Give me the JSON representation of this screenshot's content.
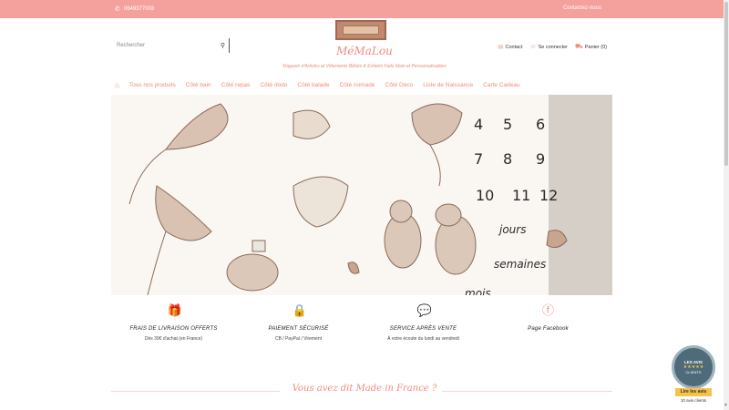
{
  "topbar": {
    "phone": "0649377003",
    "contact": "Contactez-nous"
  },
  "header": {
    "search_placeholder": "Rechercher",
    "brand": "MéMaLou",
    "tagline": "Magasin d'Articles et Vêtements Bébés & Enfants Faits Main et Personnalisables",
    "links": [
      {
        "icon": "mail-icon",
        "label": "Contact"
      },
      {
        "icon": "user-icon",
        "label": "Se connecter"
      },
      {
        "icon": "cart-icon",
        "label": "Panier (0)"
      }
    ]
  },
  "nav": {
    "items": [
      "Tous nos produits",
      "Côté bain",
      "Côté repas",
      "Côté dodo",
      "Côté balade",
      "Côté nomade",
      "Côté Déco",
      "Liste de Naissance",
      "Carte Cadeau"
    ]
  },
  "features": [
    {
      "icon": "gift-icon",
      "title": "FRAIS DE LIVRAISON OFFERTS",
      "sub": "Dès 39€ d'achat (en France)"
    },
    {
      "icon": "lock-icon",
      "title": "PAIEMENT SÉCURISÉ",
      "sub": "CB / PayPal / Virement"
    },
    {
      "icon": "chat-icon",
      "title": "SERVICE APRÈS VENTE",
      "sub": "À votre écoute du lundi au vendredi"
    },
    {
      "icon": "facebook-icon",
      "title": "Page Facebook",
      "sub": ""
    }
  ],
  "section": {
    "title": "Vous avez dit Made in France ?"
  },
  "reviews": {
    "badge_top": "LES AVIS",
    "badge_bottom": "CLIENTS",
    "stars": "★★★★★",
    "link": "Lire les avis",
    "count": "10 avis clients"
  },
  "colors": {
    "accent": "#f08c7c",
    "topbar": "#f4a09c"
  }
}
